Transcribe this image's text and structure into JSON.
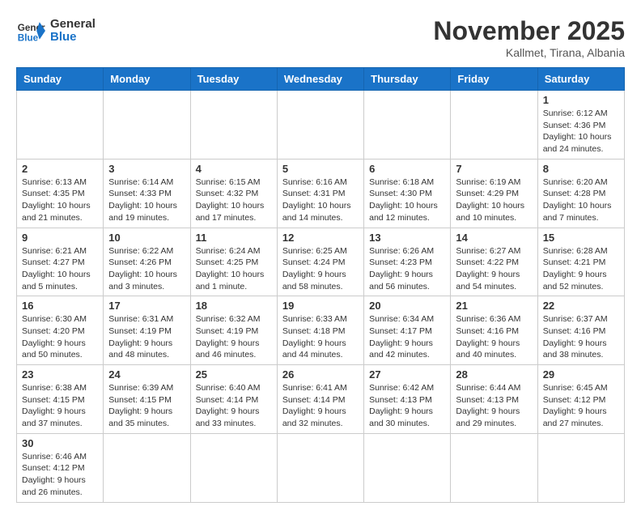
{
  "header": {
    "logo_general": "General",
    "logo_blue": "Blue",
    "month": "November 2025",
    "location": "Kallmet, Tirana, Albania"
  },
  "days_of_week": [
    "Sunday",
    "Monday",
    "Tuesday",
    "Wednesday",
    "Thursday",
    "Friday",
    "Saturday"
  ],
  "weeks": [
    [
      {
        "day": "",
        "info": ""
      },
      {
        "day": "",
        "info": ""
      },
      {
        "day": "",
        "info": ""
      },
      {
        "day": "",
        "info": ""
      },
      {
        "day": "",
        "info": ""
      },
      {
        "day": "",
        "info": ""
      },
      {
        "day": "1",
        "info": "Sunrise: 6:12 AM\nSunset: 4:36 PM\nDaylight: 10 hours and 24 minutes."
      }
    ],
    [
      {
        "day": "2",
        "info": "Sunrise: 6:13 AM\nSunset: 4:35 PM\nDaylight: 10 hours and 21 minutes."
      },
      {
        "day": "3",
        "info": "Sunrise: 6:14 AM\nSunset: 4:33 PM\nDaylight: 10 hours and 19 minutes."
      },
      {
        "day": "4",
        "info": "Sunrise: 6:15 AM\nSunset: 4:32 PM\nDaylight: 10 hours and 17 minutes."
      },
      {
        "day": "5",
        "info": "Sunrise: 6:16 AM\nSunset: 4:31 PM\nDaylight: 10 hours and 14 minutes."
      },
      {
        "day": "6",
        "info": "Sunrise: 6:18 AM\nSunset: 4:30 PM\nDaylight: 10 hours and 12 minutes."
      },
      {
        "day": "7",
        "info": "Sunrise: 6:19 AM\nSunset: 4:29 PM\nDaylight: 10 hours and 10 minutes."
      },
      {
        "day": "8",
        "info": "Sunrise: 6:20 AM\nSunset: 4:28 PM\nDaylight: 10 hours and 7 minutes."
      }
    ],
    [
      {
        "day": "9",
        "info": "Sunrise: 6:21 AM\nSunset: 4:27 PM\nDaylight: 10 hours and 5 minutes."
      },
      {
        "day": "10",
        "info": "Sunrise: 6:22 AM\nSunset: 4:26 PM\nDaylight: 10 hours and 3 minutes."
      },
      {
        "day": "11",
        "info": "Sunrise: 6:24 AM\nSunset: 4:25 PM\nDaylight: 10 hours and 1 minute."
      },
      {
        "day": "12",
        "info": "Sunrise: 6:25 AM\nSunset: 4:24 PM\nDaylight: 9 hours and 58 minutes."
      },
      {
        "day": "13",
        "info": "Sunrise: 6:26 AM\nSunset: 4:23 PM\nDaylight: 9 hours and 56 minutes."
      },
      {
        "day": "14",
        "info": "Sunrise: 6:27 AM\nSunset: 4:22 PM\nDaylight: 9 hours and 54 minutes."
      },
      {
        "day": "15",
        "info": "Sunrise: 6:28 AM\nSunset: 4:21 PM\nDaylight: 9 hours and 52 minutes."
      }
    ],
    [
      {
        "day": "16",
        "info": "Sunrise: 6:30 AM\nSunset: 4:20 PM\nDaylight: 9 hours and 50 minutes."
      },
      {
        "day": "17",
        "info": "Sunrise: 6:31 AM\nSunset: 4:19 PM\nDaylight: 9 hours and 48 minutes."
      },
      {
        "day": "18",
        "info": "Sunrise: 6:32 AM\nSunset: 4:19 PM\nDaylight: 9 hours and 46 minutes."
      },
      {
        "day": "19",
        "info": "Sunrise: 6:33 AM\nSunset: 4:18 PM\nDaylight: 9 hours and 44 minutes."
      },
      {
        "day": "20",
        "info": "Sunrise: 6:34 AM\nSunset: 4:17 PM\nDaylight: 9 hours and 42 minutes."
      },
      {
        "day": "21",
        "info": "Sunrise: 6:36 AM\nSunset: 4:16 PM\nDaylight: 9 hours and 40 minutes."
      },
      {
        "day": "22",
        "info": "Sunrise: 6:37 AM\nSunset: 4:16 PM\nDaylight: 9 hours and 38 minutes."
      }
    ],
    [
      {
        "day": "23",
        "info": "Sunrise: 6:38 AM\nSunset: 4:15 PM\nDaylight: 9 hours and 37 minutes."
      },
      {
        "day": "24",
        "info": "Sunrise: 6:39 AM\nSunset: 4:15 PM\nDaylight: 9 hours and 35 minutes."
      },
      {
        "day": "25",
        "info": "Sunrise: 6:40 AM\nSunset: 4:14 PM\nDaylight: 9 hours and 33 minutes."
      },
      {
        "day": "26",
        "info": "Sunrise: 6:41 AM\nSunset: 4:14 PM\nDaylight: 9 hours and 32 minutes."
      },
      {
        "day": "27",
        "info": "Sunrise: 6:42 AM\nSunset: 4:13 PM\nDaylight: 9 hours and 30 minutes."
      },
      {
        "day": "28",
        "info": "Sunrise: 6:44 AM\nSunset: 4:13 PM\nDaylight: 9 hours and 29 minutes."
      },
      {
        "day": "29",
        "info": "Sunrise: 6:45 AM\nSunset: 4:12 PM\nDaylight: 9 hours and 27 minutes."
      }
    ],
    [
      {
        "day": "30",
        "info": "Sunrise: 6:46 AM\nSunset: 4:12 PM\nDaylight: 9 hours and 26 minutes."
      },
      {
        "day": "",
        "info": ""
      },
      {
        "day": "",
        "info": ""
      },
      {
        "day": "",
        "info": ""
      },
      {
        "day": "",
        "info": ""
      },
      {
        "day": "",
        "info": ""
      },
      {
        "day": "",
        "info": ""
      }
    ]
  ]
}
